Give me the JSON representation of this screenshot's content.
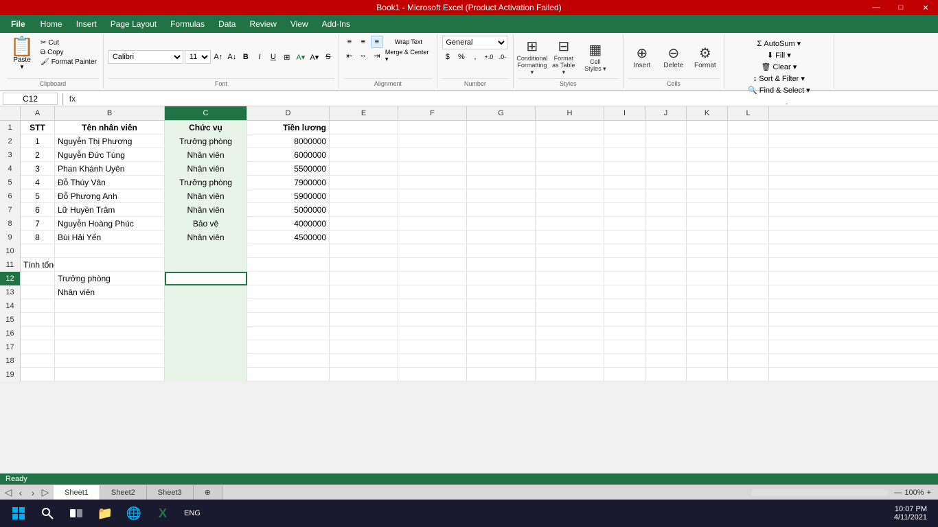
{
  "titleBar": {
    "title": "Book1 - Microsoft Excel (Product Activation Failed)",
    "minimize": "—",
    "maximize": "□",
    "close": "✕"
  },
  "menuBar": {
    "file": "File",
    "items": [
      "Home",
      "Insert",
      "Page Layout",
      "Formulas",
      "Data",
      "Review",
      "View",
      "Add-Ins"
    ]
  },
  "ribbon": {
    "clipboard": {
      "label": "Clipboard",
      "paste": "Paste",
      "cut": "Cut",
      "copy": "Copy",
      "formatPainter": "Format Painter"
    },
    "font": {
      "label": "Font",
      "name": "Calibri",
      "size": "11"
    },
    "alignment": {
      "label": "Alignment",
      "wrapText": "Wrap Text",
      "mergeCenter": "Merge & Center"
    },
    "number": {
      "label": "Number",
      "format": "General"
    },
    "styles": {
      "label": "Styles",
      "conditionalFormatting": "Conditional Formatting",
      "formatAsTable": "Format as Table",
      "cellStyles": "Cell Styles"
    },
    "cells": {
      "label": "Cells",
      "insert": "Insert",
      "delete": "Delete",
      "format": "Format"
    },
    "editing": {
      "label": "Editing",
      "autoSum": "AutoSum",
      "fill": "Fill",
      "clear": "Clear",
      "sortFilter": "Sort & Filter",
      "findSelect": "Find & Select"
    }
  },
  "formulaBar": {
    "cellName": "C12",
    "formula": ""
  },
  "columns": [
    "A",
    "B",
    "C",
    "D",
    "E",
    "F",
    "G",
    "H",
    "I",
    "J",
    "K",
    "L"
  ],
  "rows": [
    {
      "num": 1,
      "cells": [
        "STT",
        "Tên nhân viên",
        "Chức vụ",
        "Tiền lương",
        "",
        "",
        "",
        "",
        "",
        "",
        "",
        ""
      ]
    },
    {
      "num": 2,
      "cells": [
        "1",
        "Nguyễn Thị Phương",
        "Trưởng phòng",
        "8000000",
        "",
        "",
        "",
        "",
        "",
        "",
        "",
        ""
      ]
    },
    {
      "num": 3,
      "cells": [
        "2",
        "Nguyễn Đức Tùng",
        "Nhân viên",
        "6000000",
        "",
        "",
        "",
        "",
        "",
        "",
        "",
        ""
      ]
    },
    {
      "num": 4,
      "cells": [
        "3",
        "Phan Khánh Uyên",
        "Nhân viên",
        "5500000",
        "",
        "",
        "",
        "",
        "",
        "",
        "",
        ""
      ]
    },
    {
      "num": 5,
      "cells": [
        "4",
        "Đỗ Thúy Vân",
        "Trưởng phòng",
        "7900000",
        "",
        "",
        "",
        "",
        "",
        "",
        "",
        ""
      ]
    },
    {
      "num": 6,
      "cells": [
        "5",
        "Đỗ Phương Anh",
        "Nhân viên",
        "5900000",
        "",
        "",
        "",
        "",
        "",
        "",
        "",
        ""
      ]
    },
    {
      "num": 7,
      "cells": [
        "6",
        "Lữ Huyền Trâm",
        "Nhân viên",
        "5000000",
        "",
        "",
        "",
        "",
        "",
        "",
        "",
        ""
      ]
    },
    {
      "num": 8,
      "cells": [
        "7",
        "Nguyễn Hoàng Phúc",
        "Bảo  vệ",
        "4000000",
        "",
        "",
        "",
        "",
        "",
        "",
        "",
        ""
      ]
    },
    {
      "num": 9,
      "cells": [
        "8",
        "Bùi Hải Yến",
        "Nhân viên",
        "4500000",
        "",
        "",
        "",
        "",
        "",
        "",
        "",
        ""
      ]
    },
    {
      "num": 10,
      "cells": [
        "",
        "",
        "",
        "",
        "",
        "",
        "",
        "",
        "",
        "",
        "",
        ""
      ]
    },
    {
      "num": 11,
      "cells": [
        "Tính tổng lương cho các chức vụ",
        "",
        "",
        "",
        "",
        "",
        "",
        "",
        "",
        "",
        "",
        ""
      ]
    },
    {
      "num": 12,
      "cells": [
        "",
        "Trưởng phòng",
        "",
        "",
        "",
        "",
        "",
        "",
        "",
        "",
        "",
        ""
      ]
    },
    {
      "num": 13,
      "cells": [
        "",
        "Nhân viên",
        "",
        "",
        "",
        "",
        "",
        "",
        "",
        "",
        "",
        ""
      ]
    },
    {
      "num": 14,
      "cells": [
        "",
        "",
        "",
        "",
        "",
        "",
        "",
        "",
        "",
        "",
        "",
        ""
      ]
    },
    {
      "num": 15,
      "cells": [
        "",
        "",
        "",
        "",
        "",
        "",
        "",
        "",
        "",
        "",
        "",
        ""
      ]
    },
    {
      "num": 16,
      "cells": [
        "",
        "",
        "",
        "",
        "",
        "",
        "",
        "",
        "",
        "",
        "",
        ""
      ]
    },
    {
      "num": 17,
      "cells": [
        "",
        "",
        "",
        "",
        "",
        "",
        "",
        "",
        "",
        "",
        "",
        ""
      ]
    },
    {
      "num": 18,
      "cells": [
        "",
        "",
        "",
        "",
        "",
        "",
        "",
        "",
        "",
        "",
        "",
        ""
      ]
    },
    {
      "num": 19,
      "cells": [
        "",
        "",
        "",
        "",
        "",
        "",
        "",
        "",
        "",
        "",
        "",
        ""
      ]
    }
  ],
  "sheets": [
    "Sheet1",
    "Sheet2",
    "Sheet3"
  ],
  "activeSheet": "Sheet1",
  "statusBar": {
    "ready": "Ready",
    "zoom": "100%"
  },
  "taskbar": {
    "time": "10:07 PM",
    "date": "4/11/2021",
    "language": "ENG"
  }
}
